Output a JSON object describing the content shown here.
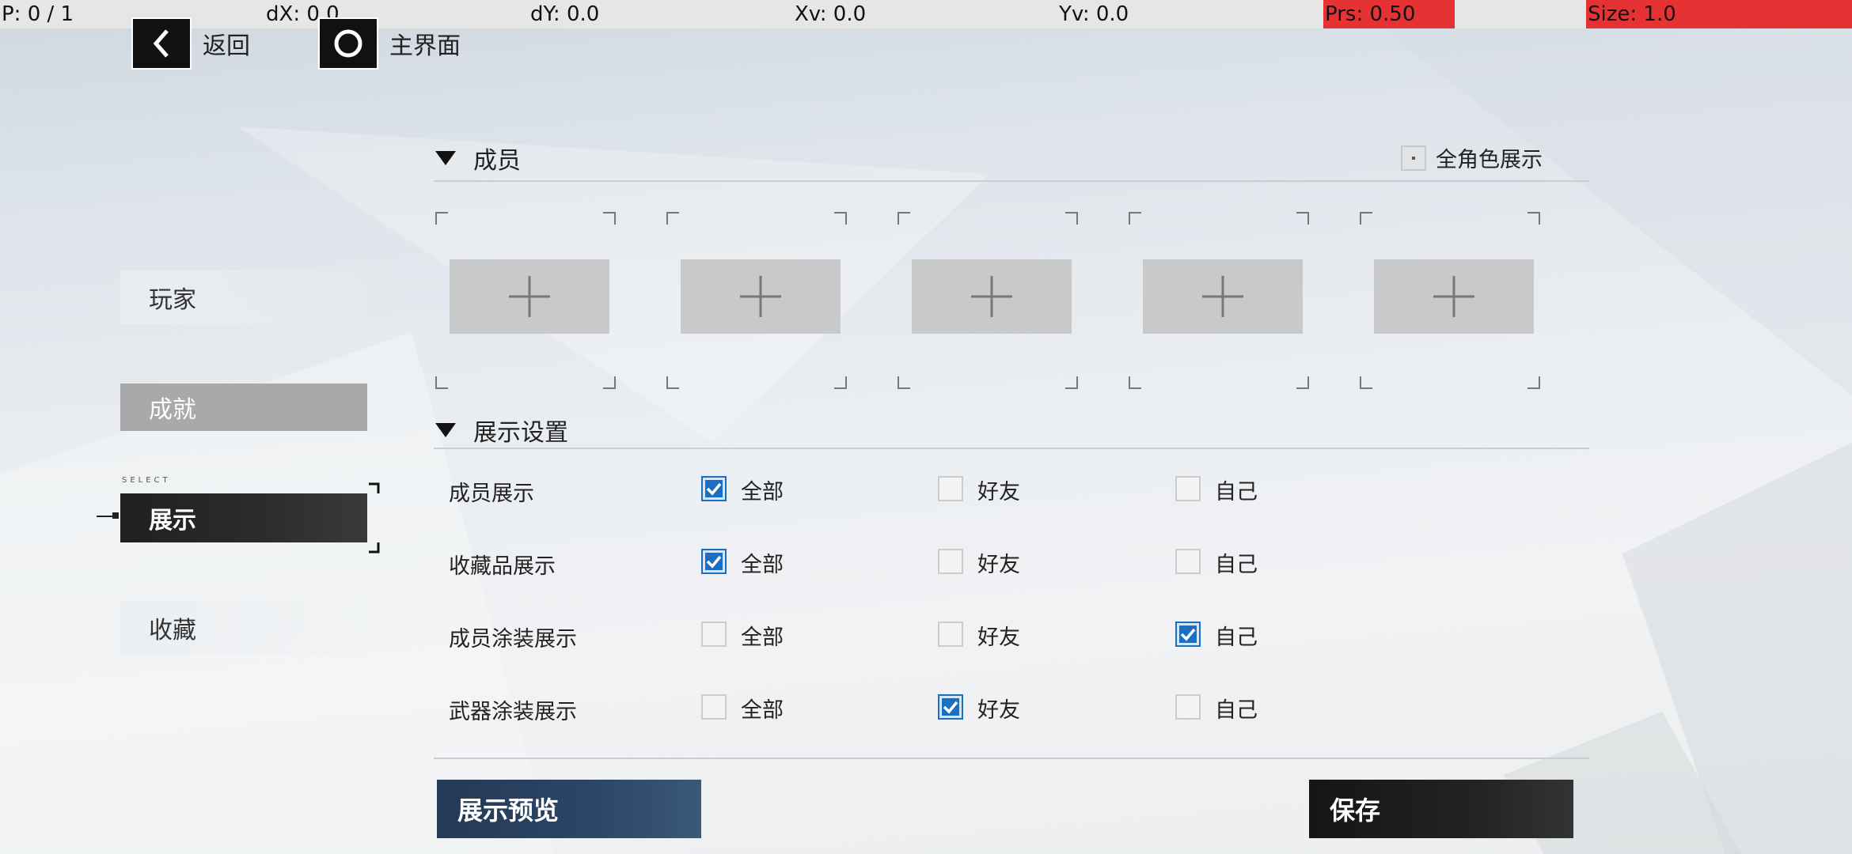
{
  "statusbar": {
    "p": "P: 0 / 1",
    "dx": "dX: 0.0",
    "dy": "dY: 0.0",
    "xv": "Xv: 0.0",
    "yv": "Yv: 0.0",
    "prs": "Prs: 0.50",
    "size": "Size: 1.0"
  },
  "header": {
    "back_label": "返回",
    "home_label": "主界面"
  },
  "sidebar": {
    "items": [
      {
        "label": "玩家"
      },
      {
        "label": "成就"
      },
      {
        "label": "展示",
        "tag": "SELECT"
      },
      {
        "label": "收藏"
      }
    ]
  },
  "members": {
    "title": "成员",
    "all_roles_label": "全角色展示",
    "all_roles_checked": false,
    "slot_count": 5
  },
  "display_settings": {
    "title": "展示设置",
    "options": [
      "全部",
      "好友",
      "自己"
    ],
    "rows": [
      {
        "label": "成员展示",
        "checked": [
          true,
          false,
          false
        ]
      },
      {
        "label": "收藏品展示",
        "checked": [
          true,
          false,
          false
        ]
      },
      {
        "label": "成员涂装展示",
        "checked": [
          false,
          false,
          true
        ]
      },
      {
        "label": "武器涂装展示",
        "checked": [
          false,
          true,
          false
        ]
      }
    ]
  },
  "footer": {
    "preview_label": "展示预览",
    "save_label": "保存"
  },
  "colors": {
    "accent": "#1b6fc2",
    "statusbar_alert": "#e63232"
  }
}
